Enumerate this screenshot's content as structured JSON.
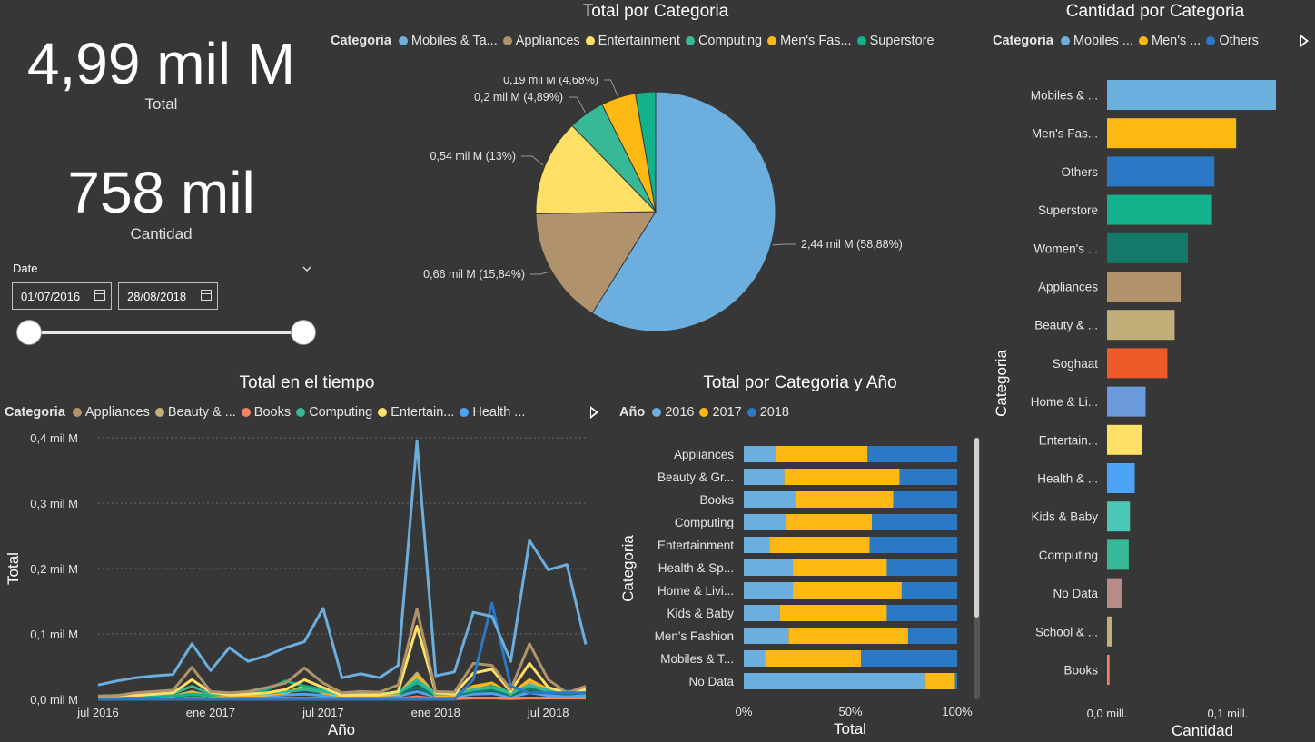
{
  "kpi": {
    "total_value": "4,99 mil M",
    "total_label": "Total",
    "cantidad_value": "758 mil",
    "cantidad_label": "Cantidad"
  },
  "date_slicer": {
    "label": "Date",
    "start": "01/07/2016",
    "end": "28/08/2018"
  },
  "legend_title": "Categoria",
  "colors": {
    "background": "#373737"
  },
  "chart_data": [
    {
      "id": "pie",
      "type": "pie",
      "title": "Total por Categoria",
      "legend": [
        {
          "name": "Mobiles & Ta...",
          "color": "#6caede"
        },
        {
          "name": "Appliances",
          "color": "#b0926d"
        },
        {
          "name": "Entertainment",
          "color": "#ffe066"
        },
        {
          "name": "Computing",
          "color": "#37b896"
        },
        {
          "name": "Men's Fas...",
          "color": "#fdb813"
        },
        {
          "name": "Superstore",
          "color": "#12b28c"
        }
      ],
      "slices": [
        {
          "name": "Mobiles & Tablets",
          "percent": 58.88,
          "label": "2,44 mil M (58,88%)",
          "color": "#6caede"
        },
        {
          "name": "Appliances",
          "percent": 15.84,
          "label": "0,66 mil M (15,84%)",
          "color": "#b0926d"
        },
        {
          "name": "Entertainment",
          "percent": 13.0,
          "label": "0,54 mil M (13%)",
          "color": "#ffe066"
        },
        {
          "name": "Computing",
          "percent": 4.89,
          "label": "0,2 mil M (4,89%)",
          "color": "#37b896"
        },
        {
          "name": "Men's Fashion",
          "percent": 4.68,
          "label": "0,19 mil M (4,68%)",
          "color": "#fdb813"
        },
        {
          "name": "Superstore",
          "percent": 2.71,
          "label": "",
          "color": "#12b28c"
        }
      ]
    },
    {
      "id": "hbar",
      "type": "bar",
      "orientation": "horizontal",
      "title": "Cantidad por Categoria",
      "xlabel": "Cantidad",
      "ylabel": "Categoria",
      "x_ticks": [
        "0,0 mill.",
        "0,1 mill."
      ],
      "xlim": [
        0,
        0.14
      ],
      "legend": [
        {
          "name": "Mobiles ...",
          "color": "#6caede"
        },
        {
          "name": "Men's ...",
          "color": "#fdb813"
        },
        {
          "name": "Others",
          "color": "#2b78c4"
        }
      ],
      "categories": [
        "Mobiles & ...",
        "Men's Fas...",
        "Others",
        "Superstore",
        "Women's ...",
        "Appliances",
        "Beauty & ...",
        "Soghaat",
        "Home & Li...",
        "Entertain...",
        "Health & ...",
        "Kids & Baby",
        "Computing",
        "No Data",
        "School & ...",
        "Books"
      ],
      "values": [
        0.14,
        0.107,
        0.089,
        0.087,
        0.067,
        0.061,
        0.056,
        0.05,
        0.032,
        0.029,
        0.023,
        0.019,
        0.018,
        0.012,
        0.004,
        0.002
      ],
      "colors": [
        "#6caede",
        "#fdb813",
        "#2b78c4",
        "#12b28c",
        "#137a69",
        "#b0926d",
        "#c2ae78",
        "#f05a28",
        "#6b9bdb",
        "#ffe066",
        "#4fa3f7",
        "#4ac7b5",
        "#37b896",
        "#b88c86",
        "#c2ae78",
        "#f28463"
      ]
    },
    {
      "id": "line",
      "type": "line",
      "title": "Total en el tiempo",
      "xlabel": "Año",
      "ylabel": "Total",
      "y_ticks": [
        "0,0 mil M",
        "0,1 mil M",
        "0,2 mil M",
        "0,3 mil M",
        "0,4 mil M"
      ],
      "ylim": [
        0,
        0.4
      ],
      "x_ticks": [
        "jul 2016",
        "ene 2017",
        "jul 2017",
        "ene 2018",
        "jul 2018"
      ],
      "legend": [
        {
          "name": "Appliances",
          "color": "#b0926d"
        },
        {
          "name": "Beauty & ...",
          "color": "#c2ae78"
        },
        {
          "name": "Books",
          "color": "#f28463"
        },
        {
          "name": "Computing",
          "color": "#37b896"
        },
        {
          "name": "Entertain...",
          "color": "#ffe066"
        },
        {
          "name": "Health ...",
          "color": "#4fa3f7"
        }
      ],
      "months": 26,
      "series": [
        {
          "name": "Mobiles & Tablets",
          "color": "#6caede",
          "values": [
            0.022,
            0.028,
            0.033,
            0.036,
            0.038,
            0.085,
            0.044,
            0.079,
            0.058,
            0.067,
            0.079,
            0.088,
            0.139,
            0.033,
            0.039,
            0.033,
            0.052,
            0.395,
            0.036,
            0.042,
            0.133,
            0.127,
            0.058,
            0.243,
            0.198,
            0.206,
            0.084
          ]
        },
        {
          "name": "Others",
          "color": "#2b78c4",
          "values": [
            0,
            0,
            0,
            0,
            0,
            0,
            0,
            0,
            0,
            0,
            0,
            0,
            0,
            0,
            0,
            0,
            0,
            0,
            0,
            0,
            0.03,
            0.147,
            0.02,
            0.01,
            0.01,
            0.01,
            0.01
          ]
        },
        {
          "name": "Appliances",
          "color": "#b0926d",
          "values": [
            0.005,
            0.006,
            0.01,
            0.012,
            0.014,
            0.049,
            0.012,
            0.01,
            0.012,
            0.018,
            0.025,
            0.048,
            0.025,
            0.01,
            0.012,
            0.011,
            0.022,
            0.138,
            0.012,
            0.011,
            0.055,
            0.052,
            0.015,
            0.085,
            0.03,
            0.01,
            0.02
          ]
        },
        {
          "name": "Entertainment",
          "color": "#ffe066",
          "values": [
            0.003,
            0.004,
            0.006,
            0.008,
            0.01,
            0.03,
            0.011,
            0.007,
            0.008,
            0.01,
            0.015,
            0.03,
            0.018,
            0.006,
            0.007,
            0.007,
            0.012,
            0.112,
            0.01,
            0.008,
            0.04,
            0.046,
            0.012,
            0.055,
            0.018,
            0.01,
            0.015
          ]
        },
        {
          "name": "Computing",
          "color": "#37b896",
          "values": [
            0.005,
            0.006,
            0.007,
            0.008,
            0.009,
            0.02,
            0.008,
            0.007,
            0.008,
            0.009,
            0.012,
            0.015,
            0.012,
            0.007,
            0.008,
            0.008,
            0.01,
            0.03,
            0.008,
            0.008,
            0.015,
            0.018,
            0.009,
            0.022,
            0.012,
            0.01,
            0.012
          ]
        },
        {
          "name": "Superstore",
          "color": "#12b28c",
          "values": [
            0.002,
            0.003,
            0.004,
            0.004,
            0.005,
            0.008,
            0.006,
            0.009,
            0.011,
            0.015,
            0.028,
            0.02,
            0.015,
            0.008,
            0.01,
            0.009,
            0.01,
            0.025,
            0.008,
            0.01,
            0.014,
            0.02,
            0.01,
            0.02,
            0.015,
            0.012,
            0.014
          ]
        },
        {
          "name": "Men's Fashion",
          "color": "#fdb813",
          "values": [
            0.001,
            0.002,
            0.003,
            0.003,
            0.004,
            0.01,
            0.004,
            0.004,
            0.005,
            0.007,
            0.01,
            0.02,
            0.01,
            0.005,
            0.006,
            0.006,
            0.008,
            0.035,
            0.006,
            0.006,
            0.02,
            0.025,
            0.008,
            0.03,
            0.015,
            0.01,
            0.012
          ]
        },
        {
          "name": "Women's Fashion",
          "color": "#137a69",
          "values": [
            0.001,
            0.002,
            0.002,
            0.003,
            0.003,
            0.006,
            0.004,
            0.005,
            0.006,
            0.008,
            0.012,
            0.014,
            0.01,
            0.005,
            0.006,
            0.006,
            0.008,
            0.018,
            0.006,
            0.006,
            0.012,
            0.014,
            0.006,
            0.016,
            0.01,
            0.008,
            0.01
          ]
        },
        {
          "name": "Books",
          "color": "#f28463",
          "values": [
            0.001,
            0.001,
            0.001,
            0.001,
            0.001,
            0.002,
            0.001,
            0.001,
            0.001,
            0.001,
            0.002,
            0.002,
            0.002,
            0.001,
            0.001,
            0.001,
            0.001,
            0.004,
            0.001,
            0.001,
            0.002,
            0.002,
            0.001,
            0.002,
            0.002,
            0.002,
            0.002
          ]
        },
        {
          "name": "Health & Sports",
          "color": "#4fa3f7",
          "values": [
            0.002,
            0.002,
            0.003,
            0.003,
            0.003,
            0.006,
            0.003,
            0.003,
            0.004,
            0.005,
            0.007,
            0.008,
            0.006,
            0.003,
            0.004,
            0.004,
            0.005,
            0.012,
            0.004,
            0.004,
            0.008,
            0.009,
            0.004,
            0.01,
            0.006,
            0.005,
            0.006
          ]
        },
        {
          "name": "Beauty & Grooming",
          "color": "#c2ae78",
          "values": [
            0.002,
            0.003,
            0.004,
            0.004,
            0.005,
            0.012,
            0.005,
            0.005,
            0.006,
            0.007,
            0.01,
            0.018,
            0.01,
            0.005,
            0.006,
            0.006,
            0.008,
            0.04,
            0.006,
            0.006,
            0.018,
            0.02,
            0.007,
            0.025,
            0.012,
            0.008,
            0.01
          ]
        }
      ]
    },
    {
      "id": "stacked",
      "type": "bar",
      "orientation": "horizontal",
      "stacked": "100%",
      "title": "Total por Categoria y Año",
      "xlabel": "Total",
      "ylabel": "Categoria",
      "legend_title": "Año",
      "x_ticks": [
        "0%",
        "50%",
        "100%"
      ],
      "categories": [
        "Appliances",
        "Beauty & Gr...",
        "Books",
        "Computing",
        "Entertainment",
        "Health & Sp...",
        "Home & Livi...",
        "Kids & Baby",
        "Men's Fashion",
        "Mobiles & T...",
        "No Data"
      ],
      "series": [
        {
          "name": "2016",
          "color": "#6caede",
          "values": [
            15,
            19,
            24,
            20,
            12,
            23,
            23,
            17,
            21,
            10,
            85
          ]
        },
        {
          "name": "2017",
          "color": "#fdb813",
          "values": [
            43,
            54,
            46,
            40,
            47,
            44,
            51,
            50,
            56,
            45,
            14
          ]
        },
        {
          "name": "2018",
          "color": "#2b78c4",
          "values": [
            42,
            27,
            30,
            40,
            41,
            33,
            26,
            33,
            23,
            45,
            1
          ]
        }
      ]
    }
  ]
}
